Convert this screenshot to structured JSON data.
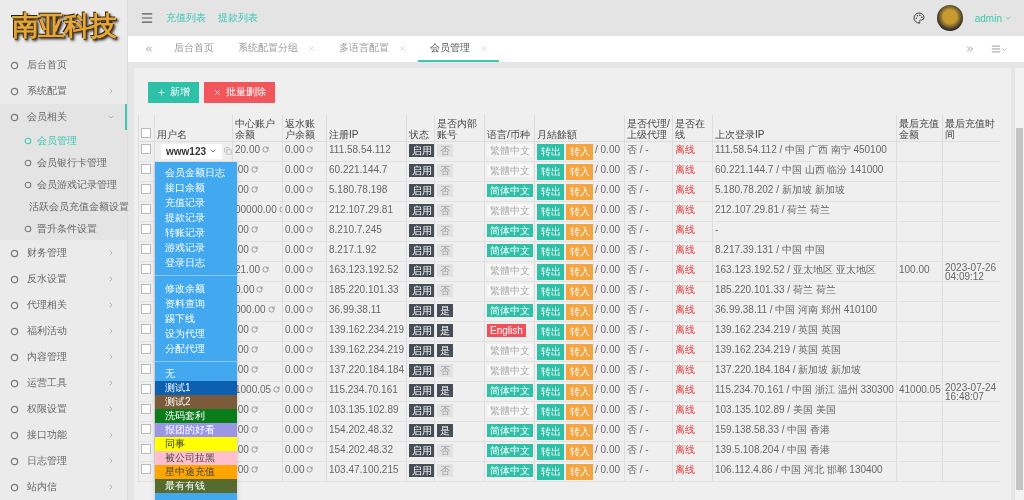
{
  "logo": {
    "text": "南亚科技"
  },
  "header": {
    "links": [
      "充值列表",
      "提款列表"
    ],
    "user": "admin"
  },
  "sidebar": {
    "items": [
      {
        "label": "后台首页",
        "kind": "link",
        "expanded": false
      },
      {
        "label": "系统配置",
        "kind": "group",
        "expanded": false
      },
      {
        "label": "会员相关",
        "kind": "group",
        "expanded": true,
        "children": [
          {
            "label": "会员管理",
            "selected": true
          },
          {
            "label": "会员银行卡管理",
            "selected": false
          },
          {
            "label": "会员游戏记录管理",
            "selected": false
          },
          {
            "label": "活跃会员充值金额设置",
            "selected": false
          },
          {
            "label": "晋升条件设置",
            "selected": false
          }
        ]
      },
      {
        "label": "财务管理",
        "kind": "group",
        "expanded": false
      },
      {
        "label": "反水设置",
        "kind": "group",
        "expanded": false
      },
      {
        "label": "代理相关",
        "kind": "group",
        "expanded": false
      },
      {
        "label": "福利活动",
        "kind": "group",
        "expanded": false
      },
      {
        "label": "内容管理",
        "kind": "group",
        "expanded": false
      },
      {
        "label": "运营工具",
        "kind": "group",
        "expanded": false
      },
      {
        "label": "权限设置",
        "kind": "group",
        "expanded": false
      },
      {
        "label": "接口功能",
        "kind": "group",
        "expanded": false
      },
      {
        "label": "日志管理",
        "kind": "group",
        "expanded": false
      },
      {
        "label": "站内信",
        "kind": "group",
        "expanded": false
      }
    ]
  },
  "tabs": [
    {
      "label": "后台首页",
      "closable": false,
      "selected": false
    },
    {
      "label": "系统配置分组",
      "closable": true,
      "selected": false
    },
    {
      "label": "多语言配置",
      "closable": true,
      "selected": false
    },
    {
      "label": "会员管理",
      "closable": true,
      "selected": true
    }
  ],
  "toolbar": [
    {
      "label": "新增",
      "kind": "add"
    },
    {
      "label": "批量删除",
      "kind": "delete"
    }
  ],
  "table": {
    "select_all": {
      "checked": false
    },
    "columns": [
      "用户名",
      "中心账户余额",
      "返水账户余额",
      "注册IP",
      "状态",
      "是否内部账号",
      "语言/币种",
      "月結餘額",
      "是否代理/上级代理",
      "是否在线",
      "上次登录IP",
      "最后充值金额",
      "最后充值时间"
    ],
    "rows": [
      {
        "checked": false,
        "username": "www123",
        "center": "20.00",
        "rebate": "0.00",
        "reg_ip": "111.58.54.112",
        "status": "启用",
        "internal": {
          "text": "否",
          "kind": "no"
        },
        "language": {
          "text": "繁體中文",
          "kind": "plain"
        },
        "out": "转出",
        "in": "转入",
        "monthly": "/ 0.00",
        "agent": "否 / -",
        "online": "离线",
        "last_ip": "111.58.54.112 / 中国 广西 南宁 450100"
      },
      {
        "checked": false,
        "center": ".00",
        "rebate": "0.00",
        "reg_ip": "60.221.144.7",
        "status": "启用",
        "internal": {
          "text": "否",
          "kind": "no"
        },
        "language": {
          "text": "繁體中文",
          "kind": "plain"
        },
        "out": "转出",
        "in": "转入",
        "monthly": "/ 0.00",
        "agent": "否 / -",
        "online": "离线",
        "last_ip": "60.221.144.7 / 中国 山西 临汾 141000"
      },
      {
        "checked": false,
        "center": ".00",
        "rebate": "0.00",
        "reg_ip": "5.180.78.198",
        "status": "启用",
        "internal": {
          "text": "否",
          "kind": "no"
        },
        "language": {
          "text": "简体中文",
          "kind": "teal"
        },
        "out": "转出",
        "in": "转入",
        "monthly": "/ 0.00",
        "agent": "否 / -",
        "online": "离线",
        "last_ip": "5.180.78.202 / 新加坡 新加坡"
      },
      {
        "checked": false,
        "center": "00000.00",
        "rebate": "0.00",
        "reg_ip": "212.107.29.81",
        "status": "启用",
        "internal": {
          "text": "否",
          "kind": "no"
        },
        "language": {
          "text": "繁體中文",
          "kind": "plain"
        },
        "out": "转出",
        "in": "转入",
        "monthly": "/ 0.00",
        "agent": "否 / -",
        "online": "离线",
        "last_ip": "212.107.29.81 / 荷兰 荷兰"
      },
      {
        "checked": false,
        "center": ".00",
        "rebate": "0.00",
        "reg_ip": "8.210.7.245",
        "status": "启用",
        "internal": {
          "text": "否",
          "kind": "no"
        },
        "language": {
          "text": "简体中文",
          "kind": "teal"
        },
        "out": "转出",
        "in": "转入",
        "monthly": "/ 0.00",
        "agent": "否 / -",
        "online": "离线",
        "last_ip": "-"
      },
      {
        "checked": false,
        "center": ".00",
        "rebate": "0.00",
        "reg_ip": "8.217.1.92",
        "status": "启用",
        "internal": {
          "text": "否",
          "kind": "no"
        },
        "language": {
          "text": "简体中文",
          "kind": "teal"
        },
        "out": "转出",
        "in": "转入",
        "monthly": "/ 0.00",
        "agent": "否 / -",
        "online": "离线",
        "last_ip": "8.217.39.131 / 中国 中国"
      },
      {
        "checked": false,
        "center": "21.00",
        "rebate": "0.00",
        "reg_ip": "163.123.192.52",
        "status": "启用",
        "internal": {
          "text": "否",
          "kind": "no"
        },
        "language": {
          "text": "繁體中文",
          "kind": "plain"
        },
        "out": "转出",
        "in": "转入",
        "monthly": "/ 0.00",
        "agent": "否 / -",
        "online": "离线",
        "last_ip": "163.123.192.52 / 亚太地区 亚太地区",
        "last_amount": "100.00",
        "last_time": "2023-07-26 04:09:12"
      },
      {
        "checked": false,
        "center": "0.00",
        "rebate": "0.00",
        "reg_ip": "185.220.101.33",
        "status": "启用",
        "internal": {
          "text": "否",
          "kind": "no"
        },
        "language": {
          "text": "繁體中文",
          "kind": "plain"
        },
        "out": "转出",
        "in": "转入",
        "monthly": "/ 0.00",
        "agent": "否 / -",
        "online": "离线",
        "last_ip": "185.220.101.33 / 荷兰 荷兰"
      },
      {
        "checked": false,
        "center": "000.00",
        "rebate": "0.00",
        "reg_ip": "36.99.38.11",
        "status": "启用",
        "internal": {
          "text": "是",
          "kind": "yes"
        },
        "language": {
          "text": "简体中文",
          "kind": "teal"
        },
        "out": "转出",
        "in": "转入",
        "monthly": "/ 0.00",
        "agent": "否 / -",
        "online": "离线",
        "last_ip": "36.99.38.11 / 中国 河南 郑州 410100"
      },
      {
        "checked": false,
        "center": ".00",
        "rebate": "0.00",
        "reg_ip": "139.162.234.219",
        "status": "启用",
        "internal": {
          "text": "是",
          "kind": "yes"
        },
        "language": {
          "text": "English",
          "kind": "red"
        },
        "out": "转出",
        "in": "转入",
        "monthly": "/ 0.00",
        "agent": "否 / -",
        "online": "离线",
        "last_ip": "139.162.234.219 / 英国 英国"
      },
      {
        "checked": false,
        "center": ".00",
        "rebate": "0.00",
        "reg_ip": "139.162.234.219",
        "status": "启用",
        "internal": {
          "text": "是",
          "kind": "yes"
        },
        "language": {
          "text": "繁體中文",
          "kind": "plain"
        },
        "out": "转出",
        "in": "转入",
        "monthly": "/ 0.00",
        "agent": "否 / -",
        "online": "离线",
        "last_ip": "139.162.234.219 / 英国 英国"
      },
      {
        "checked": false,
        "center": ".00",
        "rebate": "0.00",
        "reg_ip": "137.220.184.184",
        "status": "启用",
        "internal": {
          "text": "否",
          "kind": "no"
        },
        "language": {
          "text": "繁體中文",
          "kind": "plain"
        },
        "out": "转出",
        "in": "转入",
        "monthly": "/ 0.00",
        "agent": "否 / -",
        "online": "离线",
        "last_ip": "137.220.184.184 / 新加坡 新加坡"
      },
      {
        "checked": false,
        "center": "1000.05",
        "rebate": "0.00",
        "reg_ip": "115.234.70.161",
        "status": "启用",
        "internal": {
          "text": "是",
          "kind": "yes"
        },
        "language": {
          "text": "简体中文",
          "kind": "teal"
        },
        "out": "转出",
        "in": "转入",
        "monthly": "/ 0.00",
        "agent": "否 / -",
        "online": "离线",
        "last_ip": "115.234.70.161 / 中国 浙江 温州 330300",
        "last_amount": "41000.05",
        "last_time": "2023-07-24 16:48:07"
      },
      {
        "checked": false,
        "center": ".00",
        "rebate": "0.00",
        "reg_ip": "103.135.102.89",
        "status": "启用",
        "internal": {
          "text": "否",
          "kind": "no"
        },
        "language": {
          "text": "繁體中文",
          "kind": "plain"
        },
        "out": "转出",
        "in": "转入",
        "monthly": "/ 0.00",
        "agent": "否 / -",
        "online": "离线",
        "last_ip": "103.135.102.89 / 美国 美国"
      },
      {
        "checked": false,
        "center": ".00",
        "rebate": "0.00",
        "reg_ip": "154.202.48.32",
        "status": "启用",
        "internal": {
          "text": "是",
          "kind": "yes"
        },
        "language": {
          "text": "简体中文",
          "kind": "teal"
        },
        "out": "转出",
        "in": "转入",
        "monthly": "/ 0.00",
        "agent": "否 / -",
        "online": "离线",
        "last_ip": "159.138.58.33 / 中国 香港"
      },
      {
        "checked": false,
        "center": ".00",
        "rebate": "0.00",
        "reg_ip": "154.202.48.32",
        "status": "启用",
        "internal": {
          "text": "否",
          "kind": "no"
        },
        "language": {
          "text": "简体中文",
          "kind": "teal"
        },
        "out": "转出",
        "in": "转入",
        "monthly": "/ 0.00",
        "agent": "否 / -",
        "online": "离线",
        "last_ip": "139.5.108.204 / 中国 香港"
      },
      {
        "checked": false,
        "center": ".00",
        "rebate": "0.00",
        "reg_ip": "103.47.100.215",
        "status": "启用",
        "internal": {
          "text": "否",
          "kind": "no"
        },
        "language": {
          "text": "简体中文",
          "kind": "teal"
        },
        "out": "转出",
        "in": "转入",
        "monthly": "/ 0.00",
        "agent": "否 / -",
        "online": "离线",
        "last_ip": "106.112.4.86 / 中国 河北 邯郸 130400"
      }
    ]
  },
  "dropdown": {
    "sections": [
      [
        "会员金额日志",
        "接口余额",
        "充值记录",
        "提款记录",
        "转账记录",
        "游戏记录",
        "登录日志"
      ],
      [
        "修改余额",
        "资料查询",
        "踢下线",
        "设为代理",
        "分配代理"
      ]
    ],
    "tags": [
      {
        "label": "无"
      },
      {
        "label": "测试1",
        "color": "#0d5fb0"
      },
      {
        "label": "测试2",
        "color": "#7b5a3a"
      },
      {
        "label": "洗码套利",
        "color": "#0a7d1a"
      },
      {
        "label": "报团的好看",
        "color": "#9b95e6"
      },
      {
        "label": "同事",
        "color": "#ffff00"
      },
      {
        "label": "被公司拉黑",
        "color": "#ffc0cb"
      },
      {
        "label": "星中途充值",
        "color": "#ffa500"
      },
      {
        "label": "最有有钱",
        "color": "#556b2f"
      }
    ]
  }
}
